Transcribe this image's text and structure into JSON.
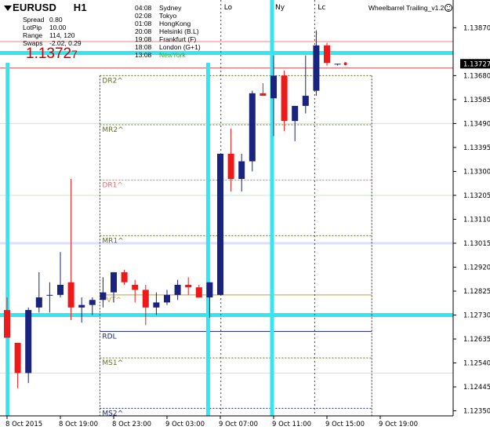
{
  "header": {
    "symbol": "EURUSD",
    "timeframe": "H1",
    "info": [
      {
        "label": "Spread",
        "value": "0.80"
      },
      {
        "label": "LotPip",
        "value": "10.00"
      },
      {
        "label": "Range",
        "value": "114, 120"
      },
      {
        "label": "Swaps",
        "value": "-2.02, 0.29"
      }
    ],
    "price_main": "1.1372",
    "price_last": "7"
  },
  "sessions": [
    {
      "time": "04:08",
      "name": "Sydney",
      "active": false
    },
    {
      "time": "02:08",
      "name": "Tokyo",
      "active": false
    },
    {
      "time": "01:08",
      "name": "HongKong",
      "active": false
    },
    {
      "time": "20:08",
      "name": "Helsinki (B.L)",
      "active": false
    },
    {
      "time": "19:08",
      "name": "Frankfurt (F)",
      "active": false
    },
    {
      "time": "18:08",
      "name": "London (G+1)",
      "active": false
    },
    {
      "time": "13:08",
      "name": "NewYork",
      "active": true
    }
  ],
  "indicator_name": "Wheelbarrel Trailing_v1.2",
  "smiley_icon": "smiley-icon",
  "session_labels": [
    "Lo",
    "Ny",
    "Lc"
  ],
  "current_price_label": "1.13727",
  "colors": {
    "bull": "#1a237e",
    "bear": "#f01818",
    "cyan": "#33e6f0",
    "current_price_box": "#000000",
    "newyork_text": "#2eaa2e",
    "price_red": "#cc0000"
  },
  "chart_data": {
    "type": "candlestick",
    "symbol": "EURUSD",
    "timeframe": "H1",
    "y_axis_ticks": [
      "1.13870",
      "1.13680",
      "1.13585",
      "1.13490",
      "1.13395",
      "1.13300",
      "1.13205",
      "1.13110",
      "1.13015",
      "1.12920",
      "1.12825",
      "1.12730",
      "1.12635",
      "1.12540",
      "1.12445",
      "1.12350"
    ],
    "ylim": [
      1.1233,
      1.1398
    ],
    "x_axis_labels": [
      "8 Oct 2015",
      "8 Oct 19:00",
      "8 Oct 23:00",
      "9 Oct 03:00",
      "9 Oct 07:00",
      "9 Oct 11:00",
      "9 Oct 15:00",
      "9 Oct 19:00"
    ],
    "x_axis_label_index": [
      0,
      5,
      10,
      15,
      20,
      25,
      30,
      35
    ],
    "candles": [
      {
        "o": 1.1275,
        "h": 1.128,
        "l": 1.1264,
        "c": 1.1264
      },
      {
        "o": 1.1262,
        "h": 1.1262,
        "l": 1.1244,
        "c": 1.125
      },
      {
        "o": 1.125,
        "h": 1.1276,
        "l": 1.1246,
        "c": 1.1275
      },
      {
        "o": 1.1276,
        "h": 1.129,
        "l": 1.1274,
        "c": 1.128
      },
      {
        "o": 1.1281,
        "h": 1.1286,
        "l": 1.1274,
        "c": 1.1281
      },
      {
        "o": 1.1281,
        "h": 1.1298,
        "l": 1.128,
        "c": 1.1285
      },
      {
        "o": 1.1286,
        "h": 1.1327,
        "l": 1.1271,
        "c": 1.1276
      },
      {
        "o": 1.1276,
        "h": 1.128,
        "l": 1.127,
        "c": 1.1277
      },
      {
        "o": 1.1277,
        "h": 1.128,
        "l": 1.1273,
        "c": 1.1279
      },
      {
        "o": 1.1279,
        "h": 1.1288,
        "l": 1.1276,
        "c": 1.1282
      },
      {
        "o": 1.1282,
        "h": 1.129,
        "l": 1.1278,
        "c": 1.129
      },
      {
        "o": 1.129,
        "h": 1.1291,
        "l": 1.1285,
        "c": 1.1286
      },
      {
        "o": 1.1285,
        "h": 1.1287,
        "l": 1.1278,
        "c": 1.1283
      },
      {
        "o": 1.1283,
        "h": 1.1285,
        "l": 1.1269,
        "c": 1.1276
      },
      {
        "o": 1.1276,
        "h": 1.1282,
        "l": 1.1273,
        "c": 1.1278
      },
      {
        "o": 1.1278,
        "h": 1.1283,
        "l": 1.1277,
        "c": 1.1281
      },
      {
        "o": 1.1281,
        "h": 1.1287,
        "l": 1.1279,
        "c": 1.1285
      },
      {
        "o": 1.1285,
        "h": 1.1288,
        "l": 1.1281,
        "c": 1.1284
      },
      {
        "o": 1.1284,
        "h": 1.1285,
        "l": 1.128,
        "c": 1.128
      },
      {
        "o": 1.128,
        "h": 1.1286,
        "l": 1.1272,
        "c": 1.1286
      },
      {
        "o": 1.1281,
        "h": 1.1337,
        "l": 1.1281,
        "c": 1.1337
      },
      {
        "o": 1.1337,
        "h": 1.1347,
        "l": 1.1322,
        "c": 1.1327
      },
      {
        "o": 1.1327,
        "h": 1.1337,
        "l": 1.1322,
        "c": 1.1334
      },
      {
        "o": 1.1334,
        "h": 1.1362,
        "l": 1.133,
        "c": 1.1361
      },
      {
        "o": 1.1361,
        "h": 1.1365,
        "l": 1.136,
        "c": 1.136
      },
      {
        "o": 1.1359,
        "h": 1.1376,
        "l": 1.1344,
        "c": 1.1368
      },
      {
        "o": 1.1368,
        "h": 1.137,
        "l": 1.1346,
        "c": 1.135
      },
      {
        "o": 1.135,
        "h": 1.1356,
        "l": 1.1342,
        "c": 1.1356
      },
      {
        "o": 1.1356,
        "h": 1.1376,
        "l": 1.1353,
        "c": 1.136
      },
      {
        "o": 1.1362,
        "h": 1.1386,
        "l": 1.136,
        "c": 1.138
      },
      {
        "o": 1.138,
        "h": 1.1381,
        "l": 1.1372,
        "c": 1.1373
      },
      {
        "o": 1.13727,
        "h": 1.13727,
        "l": 1.1372,
        "c": 1.13727
      }
    ],
    "levels": [
      {
        "name": "DR2^",
        "value": 1.1368,
        "color": "#607020",
        "style": "dotted"
      },
      {
        "name": "MR2^",
        "value": 1.13485,
        "color": "#607020",
        "style": "dotted"
      },
      {
        "name": "DR1^",
        "value": 1.13265,
        "color": "#e07070",
        "style": "dotted"
      },
      {
        "name": "MR1^",
        "value": 1.13045,
        "color": "#607020",
        "style": "dotted"
      },
      {
        "name": "PVT^",
        "value": 1.1281,
        "color": "#c8a030",
        "style": "solid"
      },
      {
        "name": "RDL",
        "value": 1.12665,
        "color": "#1a237e",
        "style": "solid"
      },
      {
        "name": "MS1^",
        "value": 1.1256,
        "color": "#607020",
        "style": "dotted"
      },
      {
        "name": "MS2^",
        "value": 1.1236,
        "color": "#1a237e",
        "style": "dotted"
      }
    ],
    "horizontal_lines": [
      {
        "value": 1.1377,
        "color": "#33e6f0",
        "width": 5
      },
      {
        "value": 1.1273,
        "color": "#33e6f0",
        "width": 5
      },
      {
        "value": 1.13815,
        "color": "#f08080",
        "width": 1
      },
      {
        "value": 1.1371,
        "color": "#c05050",
        "width": 1
      },
      {
        "value": 1.13015,
        "color": "#ddddff",
        "width": 3
      },
      {
        "value": 1.1349,
        "color": "#c8e8c8",
        "width": 1
      },
      {
        "value": 1.13205,
        "color": "#c8e8c8",
        "width": 1
      },
      {
        "value": 1.125,
        "color": "#c8e8c8",
        "width": 1
      }
    ],
    "session_vertical_lines": [
      {
        "label": "Lo",
        "index": 20.2,
        "style": "dotted"
      },
      {
        "label": "Ny",
        "index": 25.0,
        "style": "cyan"
      },
      {
        "label": "Lc",
        "index": 29.0,
        "style": "dotted"
      }
    ],
    "cyan_verticals": [
      0.2,
      19.0,
      25.0
    ],
    "pivot_start_index": 9,
    "pivot_end_index": 34.5,
    "current_price": 1.13727
  }
}
